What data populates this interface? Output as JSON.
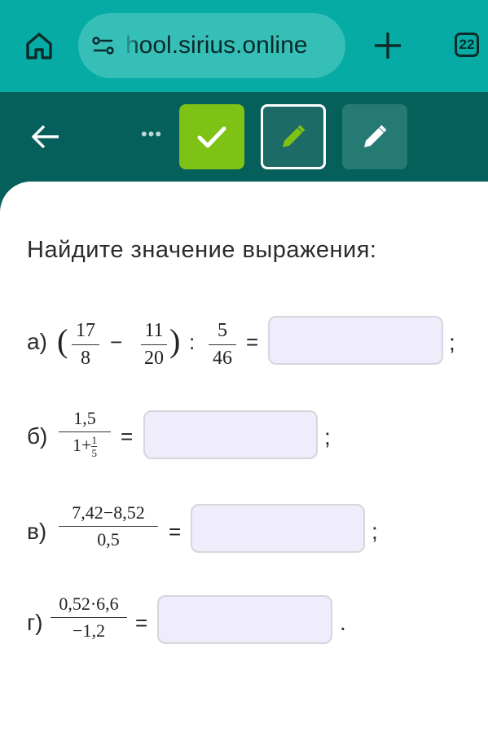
{
  "browser": {
    "url": "hool.sirius.online",
    "tab_count": "22"
  },
  "content": {
    "prompt": "Найдите значение выражения:",
    "problems": [
      {
        "label": "а)",
        "frac1_num": "17",
        "frac1_den": "8",
        "minus": "−",
        "frac2_num": "11",
        "frac2_den": "20",
        "colon": ":",
        "frac3_num": "5",
        "frac3_den": "46",
        "equals": "=",
        "answer": "",
        "end": ";"
      },
      {
        "label": "б)",
        "num": "1,5",
        "den_prefix": "1+",
        "den_sub_num": "1",
        "den_sub_den": "5",
        "equals": "=",
        "answer": "",
        "end": ";"
      },
      {
        "label": "в)",
        "num": "7,42−8,52",
        "den": "0,5",
        "equals": "=",
        "answer": "",
        "end": ";"
      },
      {
        "label": "г)",
        "num": "0,52·6,6",
        "den": "−1,2",
        "equals": "=",
        "answer": "",
        "end": "."
      }
    ]
  },
  "colors": {
    "browser_bar": "#05aba4",
    "toolbar": "#055f5a",
    "check_button": "#7dc215",
    "answer_field": "#efedfb"
  }
}
